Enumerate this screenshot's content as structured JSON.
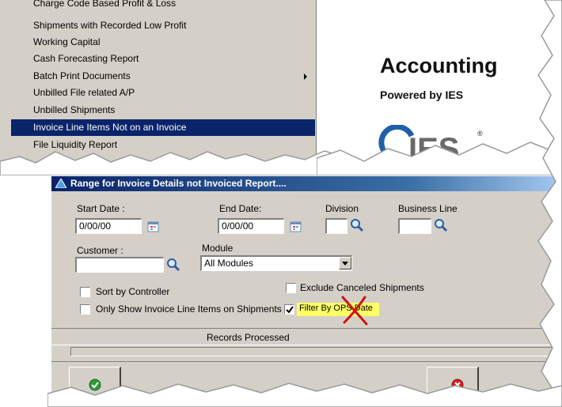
{
  "menu": {
    "items": [
      {
        "label": "Charge Code Based Profit & Loss",
        "selected": false,
        "has_submenu": false
      },
      {
        "label": "Shipments with Recorded Low Profit",
        "selected": false,
        "has_submenu": false
      },
      {
        "label": "Working Capital",
        "selected": false,
        "has_submenu": false
      },
      {
        "label": "Cash Forecasting Report",
        "selected": false,
        "has_submenu": false
      },
      {
        "label": "Batch Print Documents",
        "selected": false,
        "has_submenu": true
      },
      {
        "label": "Unbilled File related A/P",
        "selected": false,
        "has_submenu": false
      },
      {
        "label": "Unbilled Shipments",
        "selected": false,
        "has_submenu": false
      },
      {
        "label": "Invoice Line Items Not on an Invoice",
        "selected": true,
        "has_submenu": false
      },
      {
        "label": "File Liquidity Report",
        "selected": false,
        "has_submenu": false
      }
    ]
  },
  "splash": {
    "title": "Accounting",
    "subtitle": "Powered by IES",
    "logo_text": "IES",
    "registered_mark": "®"
  },
  "dialog": {
    "title": "Range for Invoice Details not Invoiced Report....",
    "start_date": {
      "label": "Start Date :",
      "value": "0/00/00"
    },
    "end_date": {
      "label": "End Date:",
      "value": "0/00/00"
    },
    "division": {
      "label": "Division",
      "value": ""
    },
    "business_line": {
      "label": "Business Line",
      "value": ""
    },
    "customer": {
      "label": "Customer :",
      "value": ""
    },
    "module": {
      "label": "Module",
      "value": "All Modules"
    },
    "checkboxes": {
      "sort_by_controller": {
        "label": "Sort by Controller",
        "checked": false
      },
      "only_show_invoice_line_items": {
        "label": "Only Show Invoice Line Items on Shipments",
        "checked": false
      },
      "exclude_canceled": {
        "label": "Exclude Canceled Shipments",
        "checked": false
      },
      "filter_by_ops_date": {
        "label": "Filter By OPS Date",
        "checked": true
      }
    },
    "records_processed_label": "Records Processed",
    "progress": 0
  },
  "colors": {
    "dialog_bg": "#d4d0c8",
    "selection": "#0a246a",
    "highlight": "#ffff66",
    "annotation_x": "#d01010",
    "ok_icon": "#2e9b3a",
    "cancel_icon": "#d62020"
  },
  "icons": {
    "calendar": "calendar-icon",
    "search": "magnifier-icon",
    "dropdown": "chevron-down-icon",
    "ok": "checkmark-icon",
    "cancel": "close-icon",
    "annotation": "red-x-mark"
  }
}
